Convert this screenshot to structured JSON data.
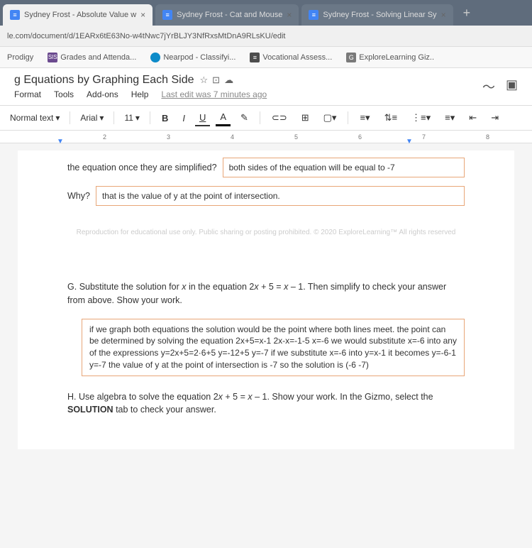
{
  "tabs": [
    {
      "title": "Sydney Frost - Absolute Value w",
      "icon": "≡"
    },
    {
      "title": "Sydney Frost - Cat and Mouse",
      "icon": "≡"
    },
    {
      "title": "Sydney Frost - Solving Linear Sy",
      "icon": "≡"
    }
  ],
  "url": "le.com/document/d/1EARx6tE63No-w4tNwc7jYrBLJY3NfRxsMtDnA9RLsKU/edit",
  "bookmarks": [
    {
      "label": "Prodigy",
      "color": ""
    },
    {
      "label": "Grades and Attenda...",
      "color": "#6b4a8f"
    },
    {
      "label": "Nearpod - Classifyi...",
      "color": "#0d8bc9"
    },
    {
      "label": "Vocational Assess...",
      "color": "#4d4d4d"
    },
    {
      "label": "ExploreLearning Giz..",
      "color": "#7a7a7a"
    }
  ],
  "doc": {
    "title": "g Equations by Graphing Each Side",
    "menus": [
      "Format",
      "Tools",
      "Add-ons",
      "Help"
    ],
    "last_edit": "Last edit was 7 minutes ago"
  },
  "toolbar": {
    "style": "Normal text",
    "font": "Arial",
    "size": "11",
    "bold": "B",
    "italic": "I",
    "underline": "U",
    "color": "A"
  },
  "ruler": [
    "2",
    "3",
    "4",
    "5",
    "6",
    "7",
    "8"
  ],
  "content": {
    "q1_prefix": "the equation once they are simplified?",
    "q1_answer": "both sides of the equation will be equal  to -7",
    "q2_prefix": "Why?",
    "q2_answer": "that is the value of y at the point of intersection.",
    "copyright": "Reproduction for educational use only. Public sharing or posting prohibited. © 2020 ExploreLearning™ All rights reserved",
    "qG_label": "G.",
    "qG_text1": "Substitute the solution for ",
    "qG_x": "x",
    "qG_text2": " in the equation 2",
    "qG_eq1": "x",
    "qG_text3": " + 5 = ",
    "qG_eq2": "x",
    "qG_text4": " – 1. Then simplify to check your answer from above. Show your work.",
    "qG_answer": "if we graph both equations the solution would be the point where both lines meet. the point can be determined by solving the equation 2x+5=x-1  2x-x=-1-5   x=-6   we would substitute x=-6 into any  of the expressions   y=2x+5=2·6+5  y=-12+5  y=-7  if we  substitute x=-6 into y=x-1 it becomes   y=-6-1  y=-7  the value of y at the point of intersection is -7    so the solution is (-6 -7)",
    "qH_label": "H.",
    "qH_text1": "Use algebra to solve the equation 2",
    "qH_x1": "x",
    "qH_text2": " + 5 = ",
    "qH_x2": "x",
    "qH_text3": " – 1. Show your work. In the Gizmo, select the ",
    "qH_bold": "SOLUTION",
    "qH_text4": " tab to check your answer."
  }
}
